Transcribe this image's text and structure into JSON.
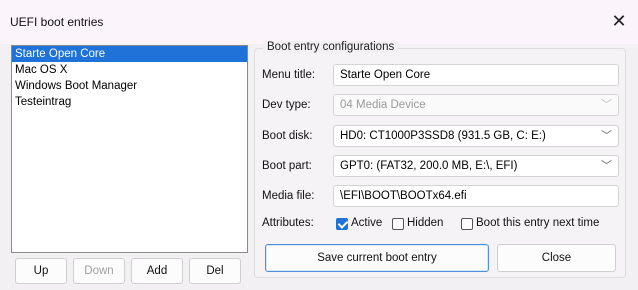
{
  "window": {
    "title": "UEFI boot entries"
  },
  "entries": {
    "items": [
      {
        "label": "Starte Open Core",
        "selected": true
      },
      {
        "label": "Mac OS X",
        "selected": false
      },
      {
        "label": "Windows Boot Manager",
        "selected": false
      },
      {
        "label": "Testeintrag",
        "selected": false
      }
    ]
  },
  "list_buttons": {
    "up": "Up",
    "down": "Down",
    "add": "Add",
    "del": "Del"
  },
  "config": {
    "group_title": "Boot entry configurations",
    "menu_title_label": "Menu title:",
    "menu_title_value": "Starte Open Core",
    "dev_type_label": "Dev type:",
    "dev_type_value": "04 Media Device",
    "boot_disk_label": "Boot disk:",
    "boot_disk_value": "HD0: CT1000P3SSD8 (931.5 GB, C: E:)",
    "boot_part_label": "Boot part:",
    "boot_part_value": "GPT0: (FAT32, 200.0 MB, E:\\, EFI)",
    "media_file_label": "Media file:",
    "media_file_value": "\\EFI\\BOOT\\BOOTx64.efi",
    "attributes_label": "Attributes:",
    "active_label": "Active",
    "active_checked": true,
    "hidden_label": "Hidden",
    "hidden_checked": false,
    "boot_next_label": "Boot this entry next time",
    "boot_next_checked": false
  },
  "actions": {
    "save": "Save current boot entry",
    "close": "Close"
  },
  "icons": {
    "close": "close-icon",
    "dropdown": "chevron-down-icon"
  },
  "colors": {
    "selection": "#1e72d8",
    "accent_border": "#4d8fe0"
  }
}
